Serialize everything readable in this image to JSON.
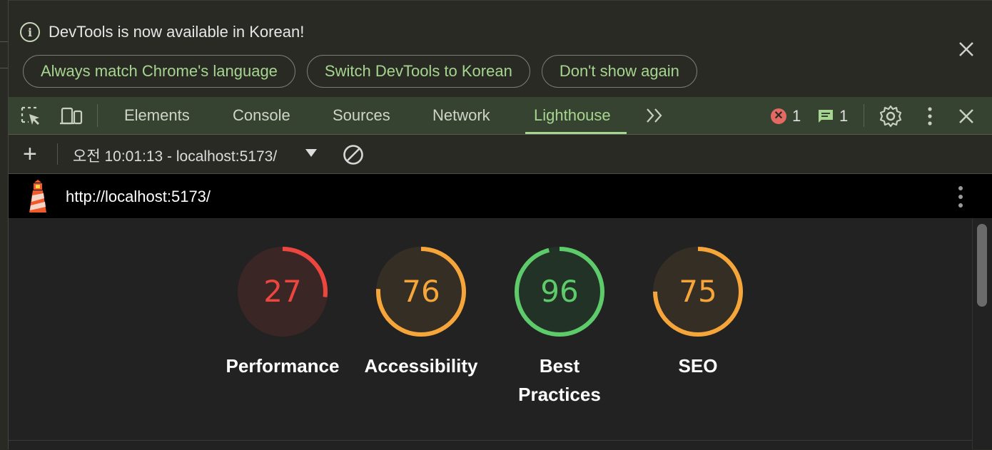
{
  "infobar": {
    "message": "DevTools is now available in Korean!",
    "buttons": [
      "Always match Chrome's language",
      "Switch DevTools to Korean",
      "Don't show again"
    ]
  },
  "tabs": {
    "items": [
      "Elements",
      "Console",
      "Sources",
      "Network",
      "Lighthouse"
    ],
    "active": "Lighthouse",
    "error_count": "1",
    "message_count": "1"
  },
  "report_toolbar": {
    "selected_report": "오전 10:01:13 - localhost:5173/"
  },
  "urlbar": {
    "url": "http://localhost:5173/"
  },
  "scores": [
    {
      "label": "Performance",
      "value": 27,
      "color": "#ec463f",
      "bg": "#3b2626"
    },
    {
      "label": "Accessibility",
      "value": 76,
      "color": "#f6a53a",
      "bg": "#352e24"
    },
    {
      "label": "Best Practices",
      "value": 96,
      "color": "#5ecb6b",
      "bg": "#233226"
    },
    {
      "label": "SEO",
      "value": 75,
      "color": "#f6a53a",
      "bg": "#352e24"
    }
  ],
  "colors": {
    "accent_green": "#a6d58f",
    "tabbar_bg": "#374331"
  }
}
